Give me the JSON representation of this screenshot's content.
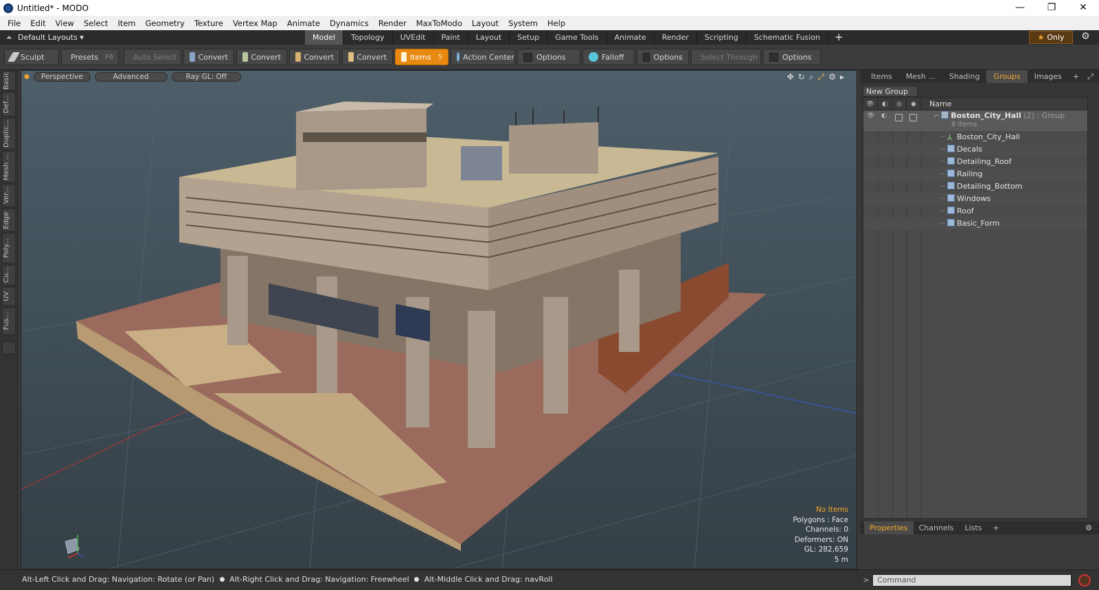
{
  "window": {
    "title": "Untitled* - MODO",
    "controls": [
      "—",
      "❐",
      "✕"
    ]
  },
  "menu": [
    "File",
    "Edit",
    "View",
    "Select",
    "Item",
    "Geometry",
    "Texture",
    "Vertex Map",
    "Animate",
    "Dynamics",
    "Render",
    "MaxToModo",
    "Layout",
    "System",
    "Help"
  ],
  "layoutbar": {
    "layout_select": "Default Layouts ▾",
    "tabs": [
      "Model",
      "Topology",
      "UVEdit",
      "Paint",
      "Layout",
      "Setup",
      "Game Tools",
      "Animate",
      "Render",
      "Scripting",
      "Schematic Fusion"
    ],
    "active_tab": "Model",
    "plus": "+",
    "only_label": "Only"
  },
  "toolbar": {
    "sculpt": "Sculpt",
    "presets": "Presets",
    "presets_key": "F6",
    "auto_select": "Auto Select",
    "convert": "Convert",
    "items": "Items",
    "items_key": "5",
    "action_center": "Action Center",
    "options": "Options",
    "falloff": "Falloff",
    "select_through": "Select Through"
  },
  "left_tabs": [
    "Basic",
    "Def...",
    "Duplic...",
    "Mesh ...",
    "Ver...",
    "Edge",
    "Poly...",
    "Cu...",
    "UV",
    "Fus..."
  ],
  "viewport": {
    "view_mode": "Perspective",
    "advanced": "Advanced",
    "raygl": "Ray GL: Off",
    "info": {
      "selection": "No Items",
      "polygons": "Polygons : Face",
      "channels": "Channels: 0",
      "deformers": "Deformers: ON",
      "gl": "GL: 282,659",
      "scale": "5 m"
    }
  },
  "right_panel": {
    "tabs": [
      "Items",
      "Mesh ...",
      "Shading",
      "Groups",
      "Images"
    ],
    "active_tab": "Groups",
    "new_group": "New Group",
    "name_header": "Name",
    "group": {
      "name": "Boston_City_Hall",
      "count": "(2)",
      "type": ": Group",
      "sub": "8 Items"
    },
    "items": [
      "Boston_City_Hall",
      "Decals",
      "Detailing_Roof",
      "Railing",
      "Detailing_Bottom",
      "Windows",
      "Roof",
      "Basic_Form"
    ],
    "bottom_tabs": [
      "Properties",
      "Channels",
      "Lists"
    ],
    "bottom_active": "Properties"
  },
  "statusbar": {
    "hint1": "Alt-Left Click and Drag: Navigation: Rotate (or Pan)",
    "hint2": "Alt-Right Click and Drag: Navigation: Freewheel",
    "hint3": "Alt-Middle Click and Drag: navRoll"
  },
  "command": {
    "placeholder": "Command"
  },
  "colors": {
    "accent": "#e88a12",
    "highlight_text": "#f3a72c"
  }
}
